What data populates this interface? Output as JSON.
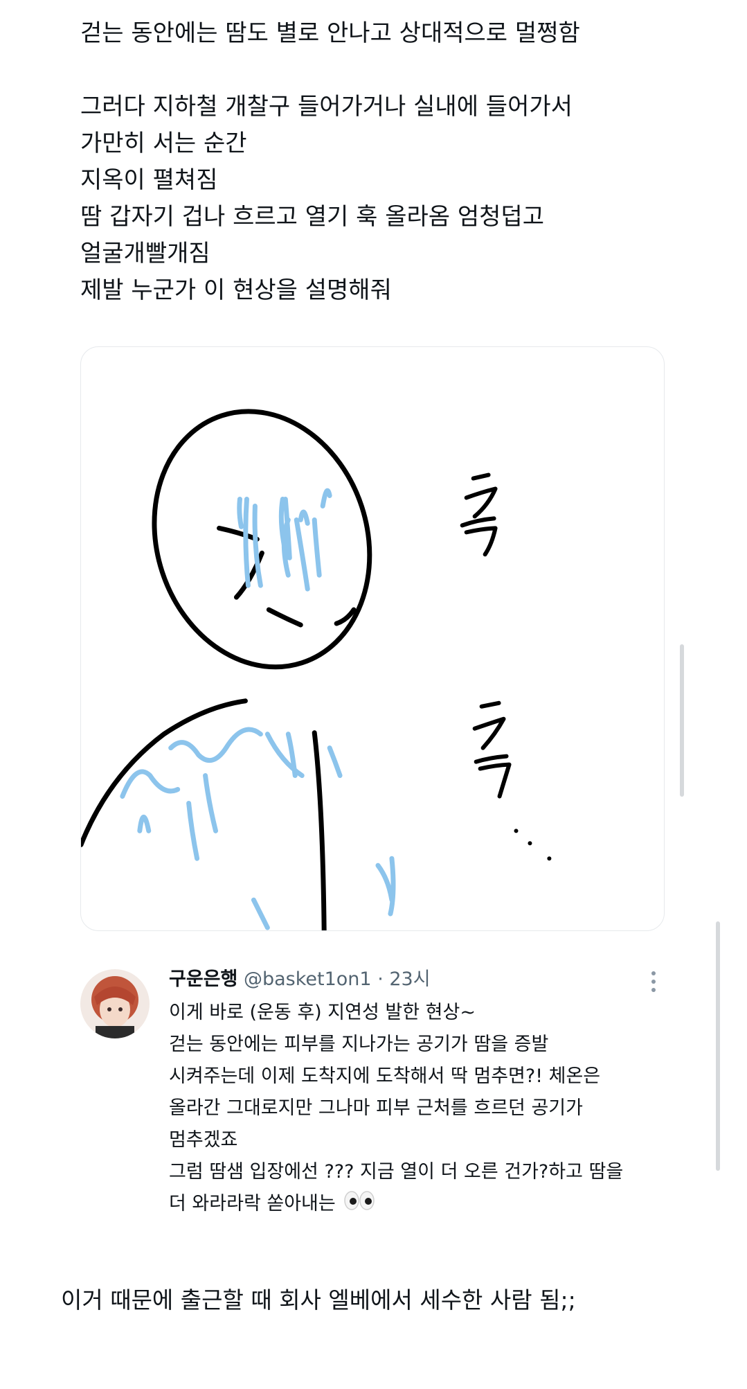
{
  "post": {
    "lines": [
      "걷는 동안에는 땀도 별로 안나고 상대적으로 멀쩡함",
      "",
      "그러다 지하철 개찰구 들어가거나 실내에 들어가서",
      "가만히 서는 순간",
      "지옥이 펼쳐짐",
      "땀 갑자기 겁나 흐르고 열기 훅 올라옴 엄청덥고",
      "얼굴개빨개짐",
      "제발 누군가 이 현상을 설명해줘"
    ]
  },
  "image": {
    "description_icon": "sweating-person-drawing",
    "caption_glyphs": [
      "후",
      "후",
      "..."
    ]
  },
  "reply": {
    "name": "구운은행",
    "handle": "@basket1on1",
    "dot": "·",
    "time": "23시",
    "more_icon": "more-vertical-icon",
    "lines": [
      "이게 바로 (운동 후) 지연성 발한 현상~",
      "걷는 동안에는 피부를 지나가는 공기가 땀을 증발",
      "시켜주는데 이제 도착지에 도착해서 딱 멈추면?! 체온은",
      "올라간 그대로지만 그나마 피부 근처를 흐르던 공기가",
      "멈추겠죠",
      "그럼 땀샘 입장에선 ??? 지금 열이 더 오른 건가?하고 땀을",
      "더 와라라락 쏟아내는"
    ],
    "eyes_icon": "eyes-emoji-icon"
  },
  "footer": {
    "text": "이거 때문에 출근할 때 회사 엘베에서 세수한 사람 됨;;"
  },
  "colors": {
    "text": "#0f1419",
    "muted": "#536471",
    "sweat": "#8cc4ec",
    "ink": "#000000"
  }
}
